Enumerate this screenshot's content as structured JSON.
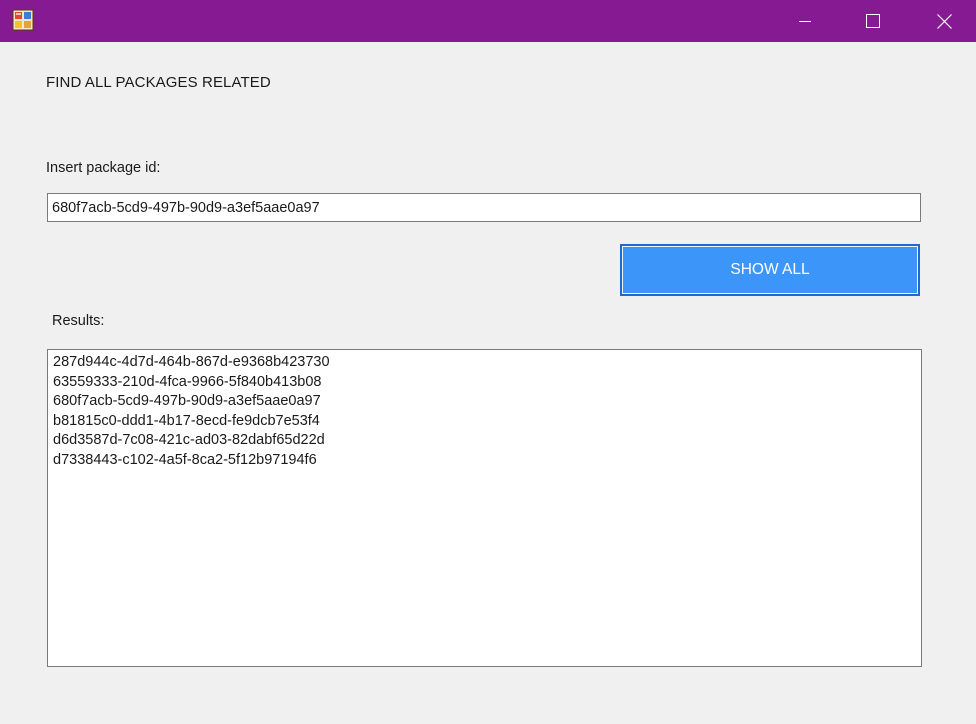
{
  "window": {
    "titlebar_color": "#861a93",
    "icons": {
      "app": "app-icon",
      "minimize": "minimize-icon",
      "maximize": "maximize-icon",
      "close": "close-icon"
    }
  },
  "main": {
    "heading": "FIND ALL PACKAGES RELATED",
    "insert_label": "Insert package id:",
    "package_id_value": "680f7acb-5cd9-497b-90d9-a3ef5aae0a97",
    "show_all_label": "SHOW ALL",
    "show_all_color": "#3c96fa",
    "results_label": "Results:",
    "results": [
      "287d944c-4d7d-464b-867d-e9368b423730",
      "63559333-210d-4fca-9966-5f840b413b08",
      "680f7acb-5cd9-497b-90d9-a3ef5aae0a97",
      "b81815c0-ddd1-4b17-8ecd-fe9dcb7e53f4",
      "d6d3587d-7c08-421c-ad03-82dabf65d22d",
      "d7338443-c102-4a5f-8ca2-5f12b97194f6"
    ]
  }
}
